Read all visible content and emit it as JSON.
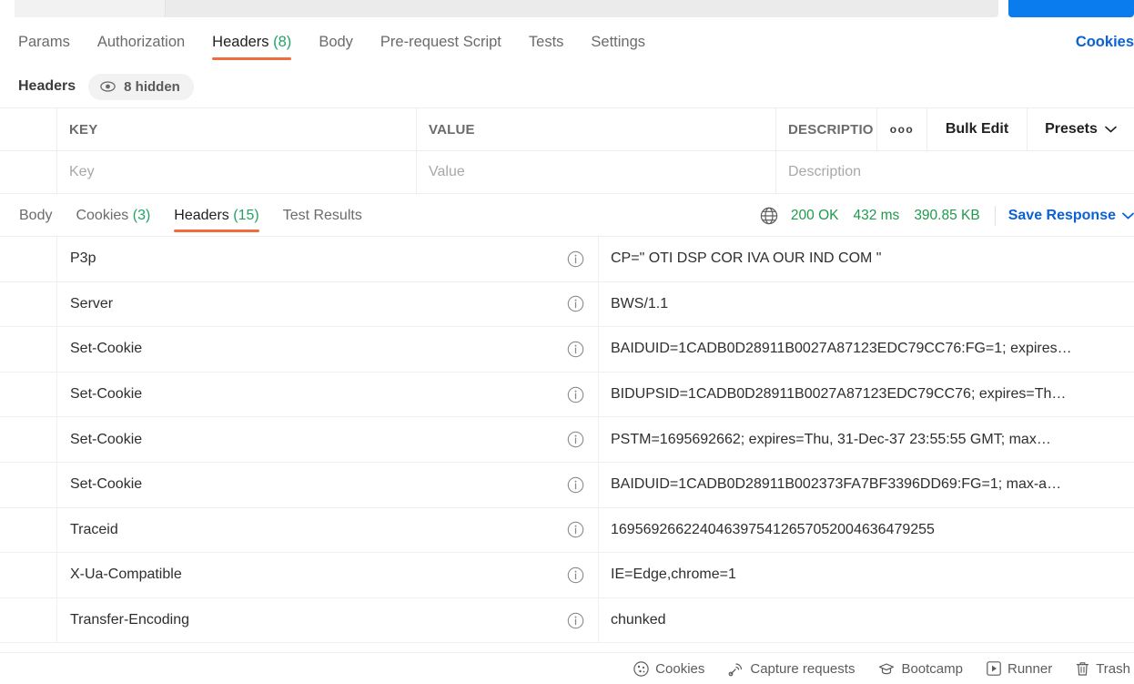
{
  "window": {
    "new_tab_button_label": ""
  },
  "request_tabs": [
    {
      "label": "Params",
      "count": "",
      "active": false
    },
    {
      "label": "Authorization",
      "count": "",
      "active": false
    },
    {
      "label": "Headers",
      "count": "(8)",
      "active": true
    },
    {
      "label": "Body",
      "count": "",
      "active": false
    },
    {
      "label": "Pre-request Script",
      "count": "",
      "active": false
    },
    {
      "label": "Tests",
      "count": "",
      "active": false
    },
    {
      "label": "Settings",
      "count": "",
      "active": false
    }
  ],
  "cookies_link": "Cookies",
  "headers_section": {
    "title": "Headers",
    "hidden_badge": "8 hidden",
    "columns": {
      "key": "KEY",
      "value": "VALUE",
      "description": "DESCRIPTIO"
    },
    "placeholders": {
      "key": "Key",
      "value": "Value",
      "description": "Description"
    },
    "actions": {
      "more": "ooo",
      "bulk_edit": "Bulk Edit",
      "presets": "Presets"
    }
  },
  "response_tabs": [
    {
      "label": "Body",
      "count": "",
      "active": false
    },
    {
      "label": "Cookies",
      "count": "(3)",
      "active": false
    },
    {
      "label": "Headers",
      "count": "(15)",
      "active": true
    },
    {
      "label": "Test Results",
      "count": "",
      "active": false
    }
  ],
  "response_meta": {
    "status": "200 OK",
    "time": "432 ms",
    "size": "390.85 KB",
    "save_response": "Save Response"
  },
  "response_headers": [
    {
      "key": "P3p",
      "value": "CP=\" OTI DSP COR IVA OUR IND COM \""
    },
    {
      "key": "Server",
      "value": "BWS/1.1"
    },
    {
      "key": "Set-Cookie",
      "value": "BAIDUID=1CADB0D28911B0027A87123EDC79CC76:FG=1; expires…"
    },
    {
      "key": "Set-Cookie",
      "value": "BIDUPSID=1CADB0D28911B0027A87123EDC79CC76; expires=Th…"
    },
    {
      "key": "Set-Cookie",
      "value": "PSTM=1695692662; expires=Thu, 31-Dec-37 23:55:55 GMT; max…"
    },
    {
      "key": "Set-Cookie",
      "value": "BAIDUID=1CADB0D28911B002373FA7BF3396DD69:FG=1; max-a…"
    },
    {
      "key": "Traceid",
      "value": "1695692662240463975412657052004636479255"
    },
    {
      "key": "X-Ua-Compatible",
      "value": "IE=Edge,chrome=1"
    },
    {
      "key": "Transfer-Encoding",
      "value": "chunked"
    }
  ],
  "status_bar": [
    {
      "label": "Cookies",
      "icon": "cookie-icon"
    },
    {
      "label": "Capture requests",
      "icon": "satellite-icon"
    },
    {
      "label": "Bootcamp",
      "icon": "graduation-cap-icon"
    },
    {
      "label": "Runner",
      "icon": "play-icon"
    },
    {
      "label": "Trash",
      "icon": "trash-icon"
    }
  ],
  "colors": {
    "accent_orange": "#f26b3a",
    "link_blue": "#0b61d6",
    "success_green": "#21a366",
    "button_blue": "#0b7ced"
  }
}
